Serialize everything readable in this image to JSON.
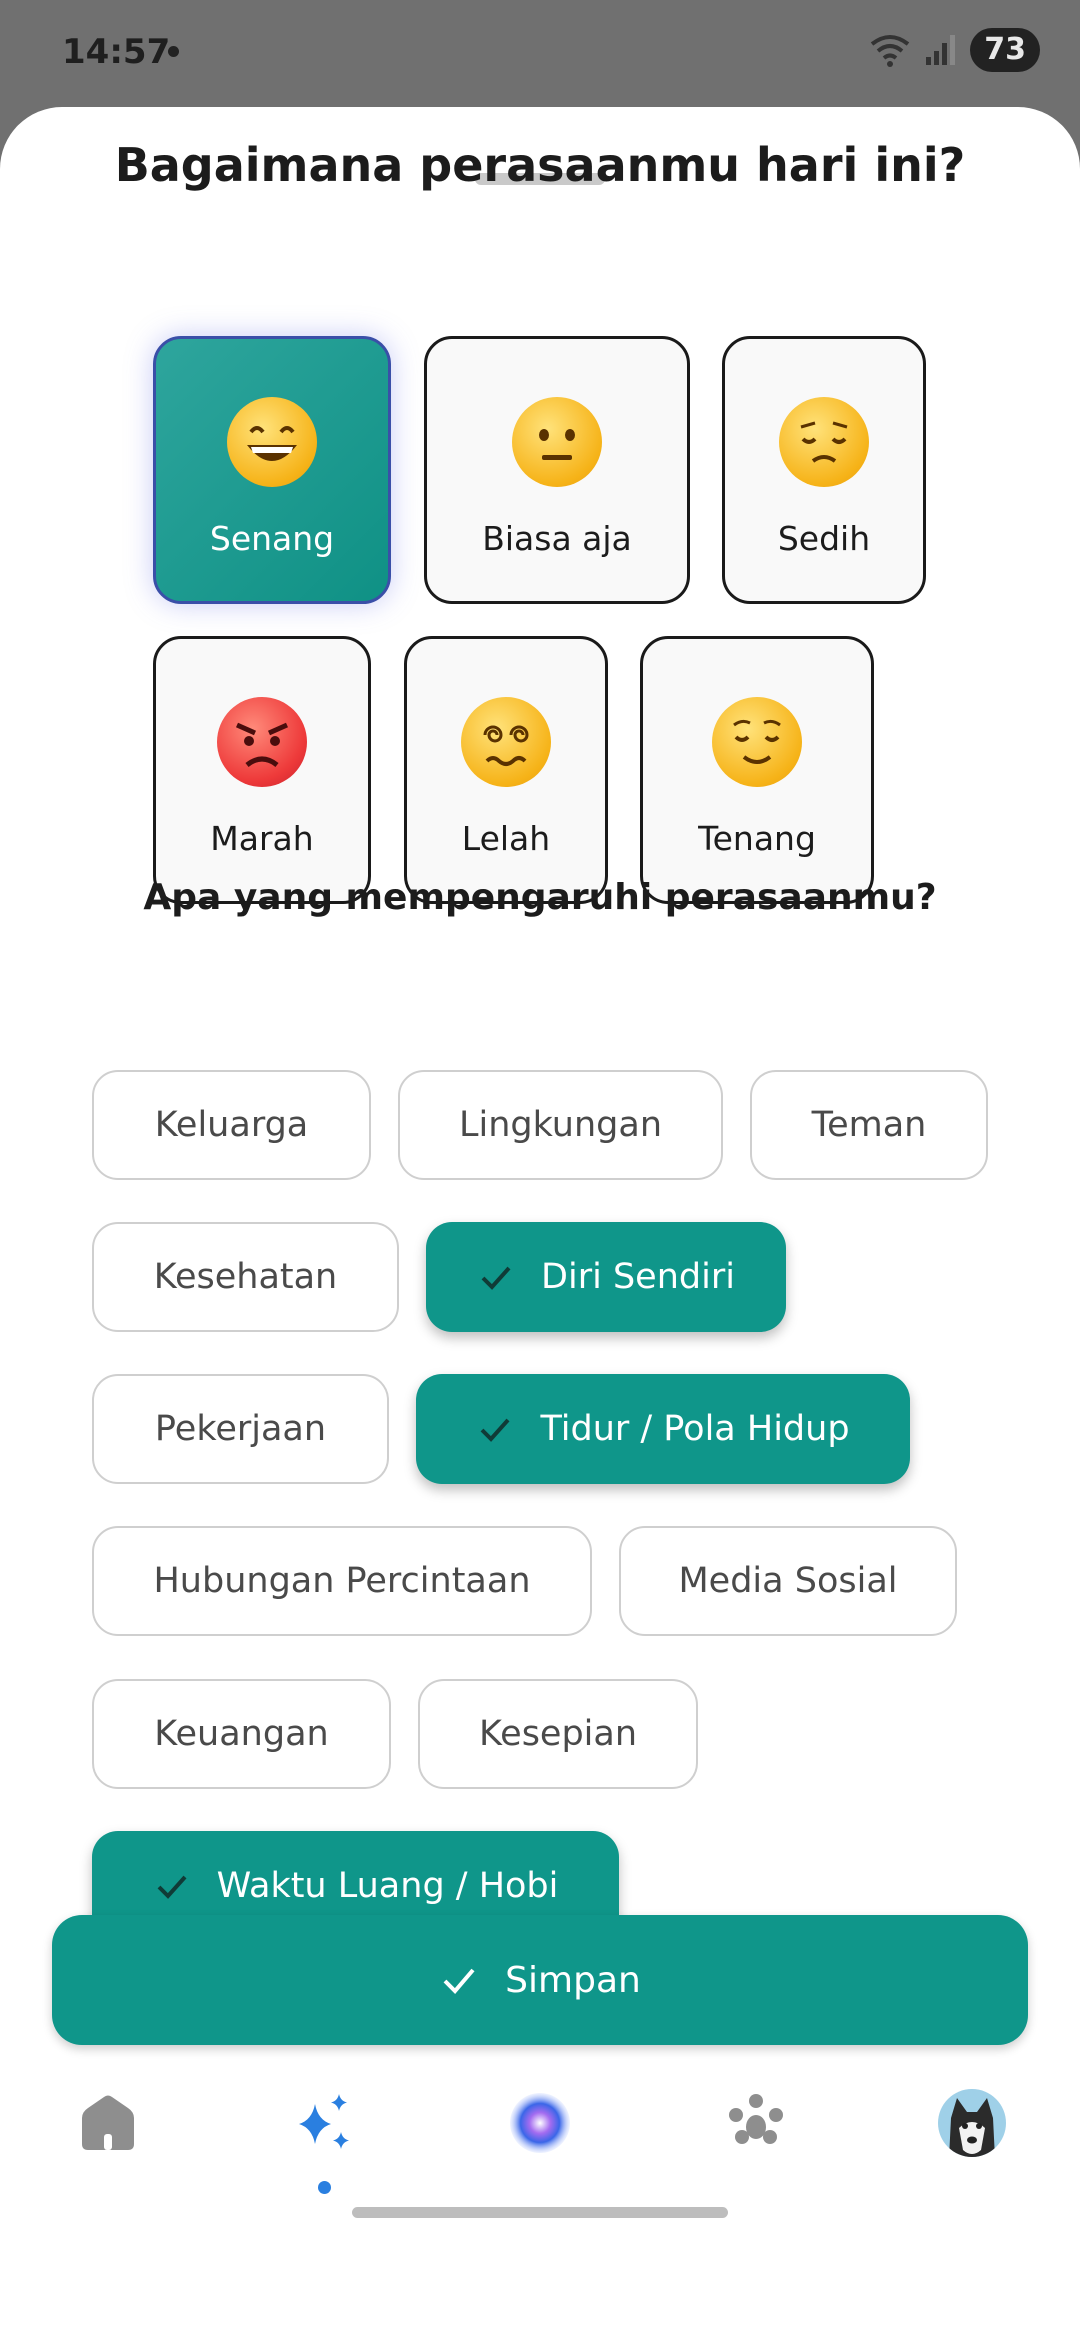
{
  "status": {
    "time": "14:57",
    "battery": "73"
  },
  "mood_section": {
    "title": "Bagaimana perasaanmu hari ini?",
    "options": [
      {
        "label": "Senang",
        "icon": "grinning-face-icon",
        "selected": true
      },
      {
        "label": "Biasa aja",
        "icon": "neutral-face-icon",
        "selected": false
      },
      {
        "label": "Sedih",
        "icon": "pensive-face-icon",
        "selected": false
      },
      {
        "label": "Marah",
        "icon": "angry-face-icon",
        "selected": false
      },
      {
        "label": "Lelah",
        "icon": "dizzy-face-icon",
        "selected": false
      },
      {
        "label": "Tenang",
        "icon": "relieved-face-icon",
        "selected": false
      }
    ]
  },
  "factor_section": {
    "title": "Apa yang mempengaruhi perasaanmu?",
    "chips": [
      {
        "label": "Keluarga",
        "selected": false
      },
      {
        "label": "Lingkungan",
        "selected": false
      },
      {
        "label": "Teman",
        "selected": false
      },
      {
        "label": "Kesehatan",
        "selected": false
      },
      {
        "label": "Diri Sendiri",
        "selected": true
      },
      {
        "label": "Pekerjaan",
        "selected": false
      },
      {
        "label": "Tidur / Pola Hidup",
        "selected": true
      },
      {
        "label": "Hubungan Percintaan",
        "selected": false
      },
      {
        "label": "Media Sosial",
        "selected": false
      },
      {
        "label": "Keuangan",
        "selected": false
      },
      {
        "label": "Kesepian",
        "selected": false
      },
      {
        "label": "Waktu Luang / Hobi",
        "selected": true
      }
    ]
  },
  "save_button": {
    "label": "Simpan",
    "icon": "check-icon"
  },
  "nav": {
    "items": [
      "home-icon",
      "sparkle-icon",
      "ai-orb-icon",
      "community-icon",
      "profile-avatar"
    ],
    "active_index": 1
  },
  "colors": {
    "accent": "#0f968a",
    "accent_light": "#2ea59d",
    "nav_active": "#2a7fe0"
  }
}
